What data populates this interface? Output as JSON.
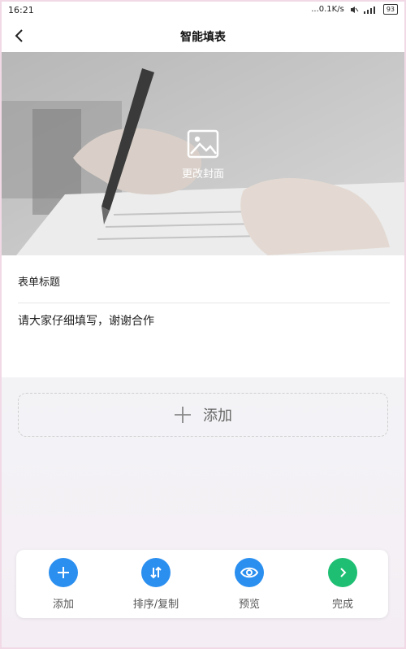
{
  "status_bar": {
    "time": "16:21",
    "speed": "...0.1K/s",
    "battery": "93"
  },
  "header": {
    "title": "智能填表"
  },
  "cover": {
    "change_label": "更改封面"
  },
  "form": {
    "title_placeholder": "表单标题",
    "description": "请大家仔细填写，谢谢合作"
  },
  "add_field": {
    "label": "添加"
  },
  "toolbar": {
    "items": [
      {
        "label": "添加",
        "icon": "plus-icon",
        "color": "#2b8ff0"
      },
      {
        "label": "排序/复制",
        "icon": "sort-icon",
        "color": "#2b8ff0"
      },
      {
        "label": "预览",
        "icon": "eye-icon",
        "color": "#2b8ff0"
      },
      {
        "label": "完成",
        "icon": "chevron-right-icon",
        "color": "#1ebf73"
      }
    ]
  },
  "colors": {
    "accent_blue": "#2b8ff0",
    "accent_green": "#1ebf73",
    "background": "#f4f4f6"
  }
}
